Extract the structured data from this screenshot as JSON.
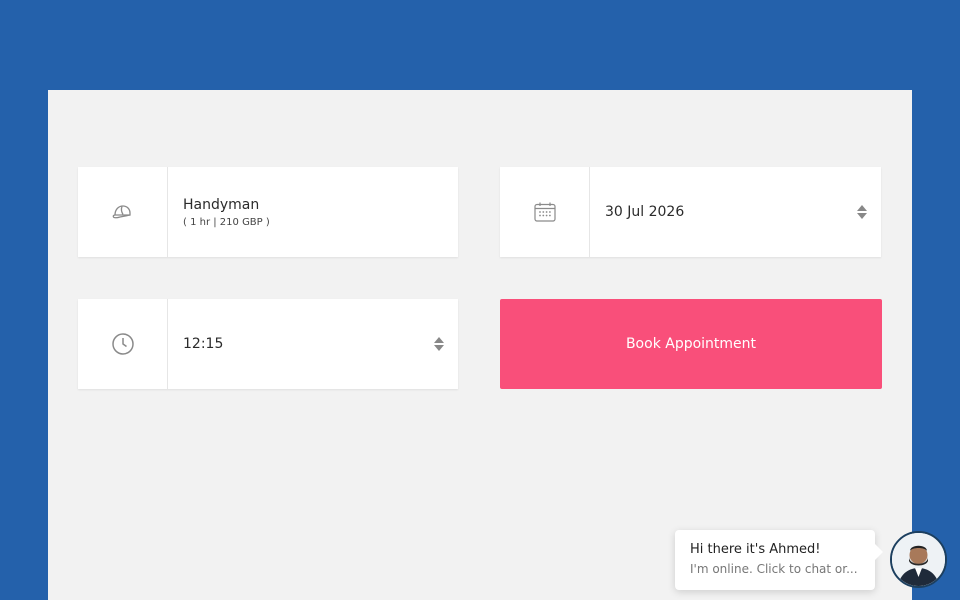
{
  "colors": {
    "background": "#2461ab",
    "panel": "#f2f2f2",
    "accent": "#f94f7a"
  },
  "service": {
    "icon": "cap-icon",
    "name": "Handyman",
    "details": "( 1 hr | 210 GBP )"
  },
  "date": {
    "icon": "calendar-icon",
    "value": "30 Jul 2026"
  },
  "time": {
    "icon": "clock-icon",
    "value": "12:15"
  },
  "book_button": {
    "label": "Book Appointment"
  },
  "chat": {
    "title": "Hi there it's Ahmed!",
    "subtitle": "I'm online. Click to chat or...",
    "avatar_icon": "avatar-icon"
  }
}
